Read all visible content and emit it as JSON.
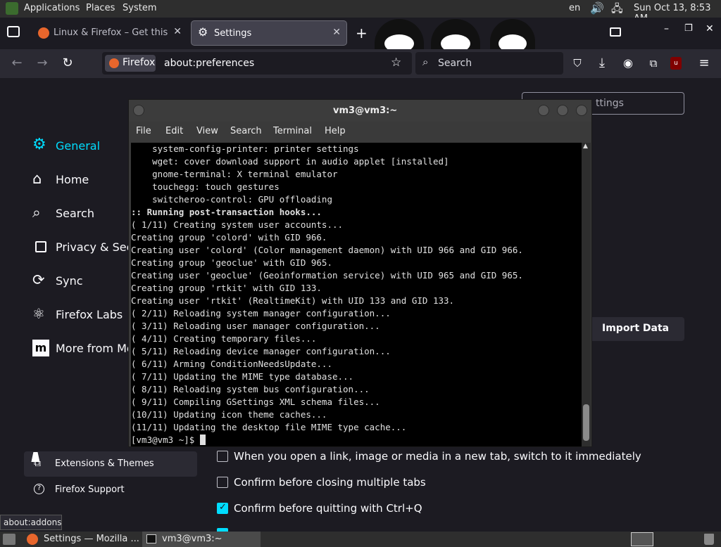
{
  "top_panel": {
    "menus": [
      "Applications",
      "Places",
      "System"
    ],
    "keyboard_layout": "en",
    "datetime": "Sun Oct 13,  8:53 AM"
  },
  "browser": {
    "tabs": [
      {
        "label": "Linux & Firefox – Get this Th"
      },
      {
        "label": "Settings"
      }
    ],
    "url_identity": "Firefox",
    "url": "about:preferences",
    "search_placeholder": "Search"
  },
  "settings": {
    "categories": [
      {
        "label": "General",
        "icon": "gear-icon",
        "active": true
      },
      {
        "label": "Home",
        "icon": "home-icon"
      },
      {
        "label": "Search",
        "icon": "search-icon"
      },
      {
        "label": "Privacy & Secu",
        "icon": "lock-icon"
      },
      {
        "label": "Sync",
        "icon": "sync-icon"
      },
      {
        "label": "Firefox Labs",
        "icon": "labs-icon"
      },
      {
        "label": "More from Mo",
        "icon": "mozilla-icon"
      }
    ],
    "find_placeholder": "ttings",
    "import_button": "Import Data",
    "footer_links": [
      {
        "label": "Extensions & Themes",
        "icon": "puzzle-icon"
      },
      {
        "label": "Firefox Support",
        "icon": "help-icon"
      }
    ],
    "options": [
      {
        "label": "When you open a link, image or media in a new tab, switch to it immediately",
        "checked": false
      },
      {
        "label": "Confirm before closing multiple tabs",
        "checked": false
      },
      {
        "label": "Confirm before quitting with Ctrl+Q",
        "checked": true
      }
    ]
  },
  "terminal": {
    "title": "vm3@vm3:~",
    "menu": [
      "File",
      "Edit",
      "View",
      "Search",
      "Terminal",
      "Help"
    ],
    "lines": [
      {
        "text": "    system-config-printer: printer settings",
        "bold": false
      },
      {
        "text": "    wget: cover download support in audio applet [installed]",
        "bold": false
      },
      {
        "text": "    gnome-terminal: X terminal emulator",
        "bold": false
      },
      {
        "text": "    touchegg: touch gestures",
        "bold": false
      },
      {
        "text": "    switcheroo-control: GPU offloading",
        "bold": false
      },
      {
        "text": ":: Running post-transaction hooks...",
        "bold": true
      },
      {
        "text": "( 1/11) Creating system user accounts...",
        "bold": false
      },
      {
        "text": "Creating group 'colord' with GID 966.",
        "bold": false
      },
      {
        "text": "Creating user 'colord' (Color management daemon) with UID 966 and GID 966.",
        "bold": false
      },
      {
        "text": "Creating group 'geoclue' with GID 965.",
        "bold": false
      },
      {
        "text": "Creating user 'geoclue' (Geoinformation service) with UID 965 and GID 965.",
        "bold": false
      },
      {
        "text": "Creating group 'rtkit' with GID 133.",
        "bold": false
      },
      {
        "text": "Creating user 'rtkit' (RealtimeKit) with UID 133 and GID 133.",
        "bold": false
      },
      {
        "text": "( 2/11) Reloading system manager configuration...",
        "bold": false
      },
      {
        "text": "( 3/11) Reloading user manager configuration...",
        "bold": false
      },
      {
        "text": "( 4/11) Creating temporary files...",
        "bold": false
      },
      {
        "text": "( 5/11) Reloading device manager configuration...",
        "bold": false
      },
      {
        "text": "( 6/11) Arming ConditionNeedsUpdate...",
        "bold": false
      },
      {
        "text": "( 7/11) Updating the MIME type database...",
        "bold": false
      },
      {
        "text": "( 8/11) Reloading system bus configuration...",
        "bold": false
      },
      {
        "text": "( 9/11) Compiling GSettings XML schema files...",
        "bold": false
      },
      {
        "text": "(10/11) Updating icon theme caches...",
        "bold": false
      },
      {
        "text": "(11/11) Updating the desktop file MIME type cache...",
        "bold": false
      }
    ],
    "prompt": "[vm3@vm3 ~]$ "
  },
  "tooltip": "about:addons",
  "taskbar": {
    "items": [
      {
        "label": "Settings — Mozilla ...",
        "icon": "firefox-icon"
      },
      {
        "label": "vm3@vm3:~",
        "icon": "terminal-icon"
      }
    ]
  },
  "colors": {
    "accent": "#00ddff",
    "bg": "#1c1b22",
    "terminal_bg": "#000000"
  }
}
